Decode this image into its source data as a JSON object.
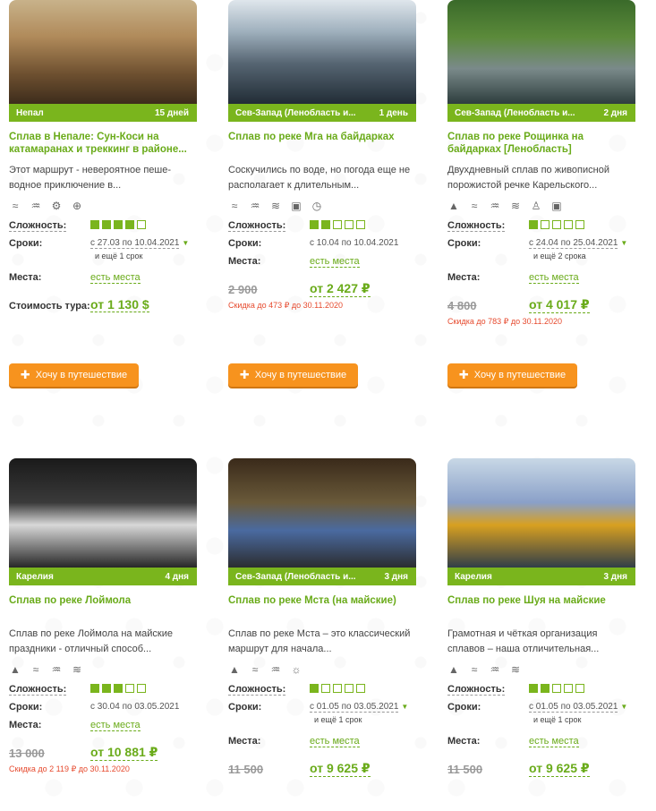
{
  "labels": {
    "difficulty": "Сложность:",
    "dates": "Сроки:",
    "places": "Места:",
    "cost": "Стоимость тура:",
    "button": "Хочу в путешествие",
    "button_icon": "plus-icon"
  },
  "cards": [
    {
      "region": "Непал",
      "duration": "15 дней",
      "title": "Сплав в Непале: Сун-Коси на катамаранах и треккинг в районе...",
      "desc": "Этот маршрут - невероятное пеше-водное приключение в...",
      "icons": [
        "waves-icon",
        "swimmer-icon",
        "bike-icon",
        "globe-icon"
      ],
      "difficulty": 4,
      "dates": "с 27.03 по 10.04.2021",
      "dates_extra": "и ещё 1 срок",
      "places": "есть места",
      "old_price": "",
      "price": "от 1 130 $",
      "discount": ""
    },
    {
      "region": "Сев-Запад (Ленобласть и...",
      "duration": "1 день",
      "title": "Сплав по реке Мга на байдарках",
      "desc": "Соскучились по воде, но погода еще не располагает к длительным...",
      "icons": [
        "waves-icon",
        "swimmer-icon",
        "rapids-icon",
        "camera-icon",
        "timer-icon"
      ],
      "difficulty": 2,
      "dates": "с 10.04 по 10.04.2021",
      "dates_extra": "",
      "places": "есть места",
      "old_price": "2 900",
      "price": "от 2 427 ₽",
      "discount": "Скидка до 473 ₽ до 30.11.2020"
    },
    {
      "region": "Сев-Запад (Ленобласть и...",
      "duration": "2 дня",
      "title": "Сплав по реке Рощинка на байдарках [Ленобласть]",
      "desc": "Двухдневный сплав по живописной порожистой речке Карельского...",
      "icons": [
        "tent-icon",
        "waves-icon",
        "swimmer-icon",
        "rapids-icon",
        "hiker-icon",
        "camera-icon"
      ],
      "difficulty": 1,
      "dates": "с 24.04 по 25.04.2021",
      "dates_extra": "и ещё 2 срока",
      "places": "есть места",
      "old_price": "4 800",
      "price": "от 4 017 ₽",
      "discount": "Скидка до 783 ₽ до 30.11.2020"
    },
    {
      "region": "Карелия",
      "duration": "4 дня",
      "title": "Сплав по реке Лоймола",
      "desc": "Сплав по реке Лоймола на майские праздники - отличный способ...",
      "icons": [
        "tent-icon",
        "waves-icon",
        "swimmer-icon",
        "rapids-icon"
      ],
      "difficulty": 3,
      "dates": "с 30.04 по 03.05.2021",
      "dates_extra": "",
      "places": "есть места",
      "old_price": "13 000",
      "price": "от 10 881 ₽",
      "discount": "Скидка до 2 119 ₽ до 30.11.2020"
    },
    {
      "region": "Сев-Запад (Ленобласть и...",
      "duration": "3 дня",
      "title": "Сплав по реке Мста (на майские)",
      "desc": "Сплав по реке Мста – это классический маршрут для начала...",
      "icons": [
        "tent-icon",
        "waves-icon",
        "swimmer-icon",
        "sun-icon"
      ],
      "difficulty": 1,
      "dates": "с 01.05 по 03.05.2021",
      "dates_extra": "и ещё 1 срок",
      "places": "есть места",
      "old_price": "11 500",
      "price": "от 9 625 ₽",
      "discount": ""
    },
    {
      "region": "Карелия",
      "duration": "3 дня",
      "title": "Сплав по реке Шуя на майские",
      "desc": "Грамотная и чёткая организация сплавов – наша отличительная...",
      "icons": [
        "tent-icon",
        "waves-icon",
        "swimmer-icon",
        "rapids-icon"
      ],
      "difficulty": 2,
      "dates": "с 01.05 по 03.05.2021",
      "dates_extra": "и ещё 1 срок",
      "places": "есть места",
      "old_price": "11 500",
      "price": "от 9 625 ₽",
      "discount": ""
    }
  ],
  "colors": {
    "accent": "#7ab51d",
    "button": "#f7931e",
    "discount": "#e64a2e"
  }
}
